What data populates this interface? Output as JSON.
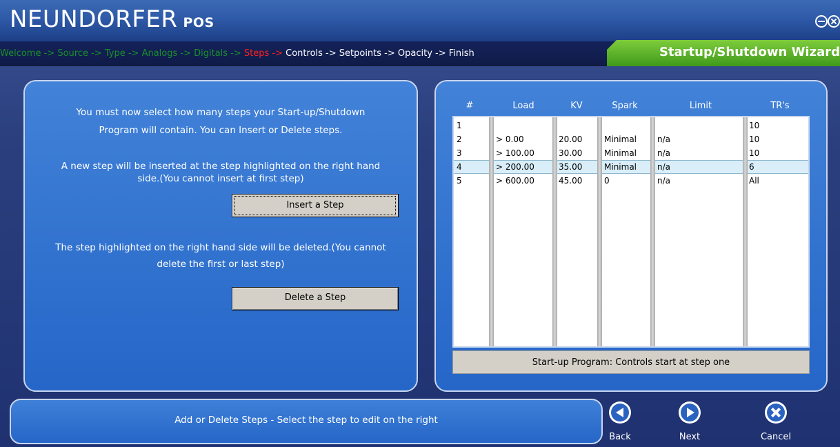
{
  "app": {
    "logo_main": "NEUNDORFER",
    "logo_sub": "POS",
    "wizard_title": "Startup/Shutdown Wizard"
  },
  "breadcrumb": {
    "steps": [
      {
        "label": "Welcome ->",
        "state": "done"
      },
      {
        "label": "Source ->",
        "state": "done"
      },
      {
        "label": "Type ->",
        "state": "done"
      },
      {
        "label": "Analogs ->",
        "state": "done"
      },
      {
        "label": "Digitals ->",
        "state": "done"
      },
      {
        "label": "Steps ->",
        "state": "current"
      },
      {
        "label": "Controls ->",
        "state": "todo"
      },
      {
        "label": "Setpoints ->",
        "state": "todo"
      },
      {
        "label": "Opacity ->",
        "state": "todo"
      },
      {
        "label": "Finish",
        "state": "todo"
      }
    ]
  },
  "left": {
    "intro_line1": "You must now select how many steps your Start-up/Shutdown",
    "intro_line2": "Program will contain. You can Insert or Delete steps.",
    "insert_line1": "A new step will be inserted at the step highlighted on the right hand",
    "insert_line2": "side.(You cannot insert at first step)",
    "insert_button": "Insert a Step",
    "delete_line1": "The step highlighted on the right hand side will be deleted.(You cannot",
    "delete_line2": "delete the first or last step)",
    "delete_button": "Delete a Step"
  },
  "table": {
    "headers": {
      "num": "#",
      "load": "Load",
      "kv": "KV",
      "spark": "Spark",
      "limit": "Limit",
      "trs": "TR's"
    },
    "rows": [
      {
        "num": "1",
        "load": "",
        "kv": "",
        "spark": "",
        "limit": "",
        "trs": "10",
        "selected": false
      },
      {
        "num": "2",
        "load": "> 0.00",
        "kv": "20.00",
        "spark": "Minimal",
        "limit": "n/a",
        "trs": "10",
        "selected": false
      },
      {
        "num": "3",
        "load": "> 100.00",
        "kv": "30.00",
        "spark": "Minimal",
        "limit": "n/a",
        "trs": "10",
        "selected": false
      },
      {
        "num": "4",
        "load": "> 200.00",
        "kv": "35.00",
        "spark": "Minimal",
        "limit": "n/a",
        "trs": "6",
        "selected": true
      },
      {
        "num": "5",
        "load": "> 600.00",
        "kv": "45.00",
        "spark": "0",
        "limit": "n/a",
        "trs": "All",
        "selected": false
      }
    ],
    "status": "Start-up Program: Controls start at step one"
  },
  "footer": {
    "status_text": "Add or Delete Steps - Select the step to edit on the right",
    "back_label": "Back",
    "next_label": "Next",
    "cancel_label": "Cancel"
  },
  "colors": {
    "done_step": "#1a8f2a",
    "current_step": "#ff2020",
    "title_tab_green": "#5cb52a",
    "selected_row": "#d9eef8"
  }
}
